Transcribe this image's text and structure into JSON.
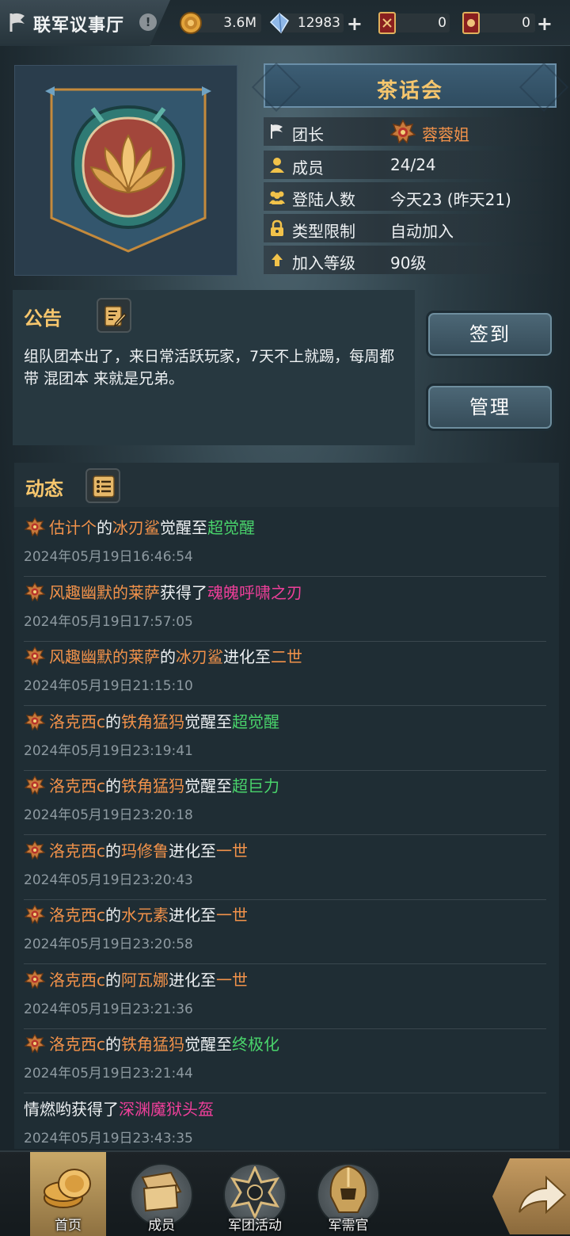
{
  "topbar": {
    "title": "联军议事厅",
    "info_icon": "!",
    "resources": [
      {
        "name": "gold",
        "icon": "coin-icon",
        "value": "3.6M",
        "plus": false
      },
      {
        "name": "diamond",
        "icon": "crystal-icon",
        "value": "12983",
        "plus": true
      },
      {
        "name": "card-a",
        "icon": "card-icon",
        "value": "0",
        "plus": false
      },
      {
        "name": "card-b",
        "icon": "card-icon",
        "value": "0",
        "plus": true
      }
    ]
  },
  "guild": {
    "name": "茶话会",
    "info": [
      {
        "key": "leader",
        "icon": "flag-icon",
        "label": "团长",
        "value": "蓉蓉姐"
      },
      {
        "key": "members",
        "icon": "person-icon",
        "label": "成员",
        "value": "24/24"
      },
      {
        "key": "logins",
        "icon": "group-icon",
        "label": "登陆人数",
        "value": "今天23 (昨天21)"
      },
      {
        "key": "type",
        "icon": "lock-icon",
        "label": "类型限制",
        "value": "自动加入"
      },
      {
        "key": "level",
        "icon": "arrow-up-icon",
        "label": "加入等级",
        "value": "90级"
      }
    ]
  },
  "notice": {
    "title": "公告",
    "text": "组队团本出了，来日常活跃玩家，7天不上就踢，每周都带 混团本 来就是兄弟。"
  },
  "actions": {
    "checkin": "签到",
    "manage": "管理"
  },
  "feed": {
    "title": "动态",
    "items": [
      {
        "icon": true,
        "parts": [
          [
            "估计个",
            "o"
          ],
          [
            "的",
            "w"
          ],
          [
            "冰刃鲨",
            "o"
          ],
          [
            "觉醒至",
            "w"
          ],
          [
            "超觉醒",
            "g"
          ]
        ],
        "time": "2024年05月19日16:46:54"
      },
      {
        "icon": true,
        "parts": [
          [
            "风趣幽默的莱萨",
            "o"
          ],
          [
            "获得了",
            "w"
          ],
          [
            "魂魄呼啸之刃",
            "p"
          ]
        ],
        "time": "2024年05月19日17:57:05"
      },
      {
        "icon": true,
        "parts": [
          [
            "风趣幽默的莱萨",
            "o"
          ],
          [
            "的",
            "w"
          ],
          [
            "冰刃鲨",
            "o"
          ],
          [
            "进化至",
            "w"
          ],
          [
            "二世",
            "o"
          ]
        ],
        "time": "2024年05月19日21:15:10"
      },
      {
        "icon": true,
        "parts": [
          [
            "洛克西c",
            "o"
          ],
          [
            "的",
            "w"
          ],
          [
            "铁角猛犸",
            "o"
          ],
          [
            "觉醒至",
            "w"
          ],
          [
            "超觉醒",
            "g"
          ]
        ],
        "time": "2024年05月19日23:19:41"
      },
      {
        "icon": true,
        "parts": [
          [
            "洛克西c",
            "o"
          ],
          [
            "的",
            "w"
          ],
          [
            "铁角猛犸",
            "o"
          ],
          [
            "觉醒至",
            "w"
          ],
          [
            "超巨力",
            "g"
          ]
        ],
        "time": "2024年05月19日23:20:18"
      },
      {
        "icon": true,
        "parts": [
          [
            "洛克西c",
            "o"
          ],
          [
            "的",
            "w"
          ],
          [
            "玛修鲁",
            "o"
          ],
          [
            "进化至",
            "w"
          ],
          [
            "一世",
            "o"
          ]
        ],
        "time": "2024年05月19日23:20:43"
      },
      {
        "icon": true,
        "parts": [
          [
            "洛克西c",
            "o"
          ],
          [
            "的",
            "w"
          ],
          [
            "水元素",
            "o"
          ],
          [
            "进化至",
            "w"
          ],
          [
            "一世",
            "o"
          ]
        ],
        "time": "2024年05月19日23:20:58"
      },
      {
        "icon": true,
        "parts": [
          [
            "洛克西c",
            "o"
          ],
          [
            "的",
            "w"
          ],
          [
            "阿瓦娜",
            "o"
          ],
          [
            "进化至",
            "w"
          ],
          [
            "一世",
            "o"
          ]
        ],
        "time": "2024年05月19日23:21:36"
      },
      {
        "icon": true,
        "parts": [
          [
            "洛克西c",
            "o"
          ],
          [
            "的",
            "w"
          ],
          [
            "铁角猛犸",
            "o"
          ],
          [
            "觉醒至",
            "w"
          ],
          [
            "终极化",
            "g"
          ]
        ],
        "time": "2024年05月19日23:21:44"
      },
      {
        "icon": false,
        "parts": [
          [
            "情燃哟",
            "w"
          ],
          [
            "获得了",
            "w"
          ],
          [
            "深渊魔狱头盔",
            "p"
          ]
        ],
        "time": "2024年05月19日23:43:35"
      }
    ]
  },
  "nav": [
    {
      "key": "home",
      "label": "首页",
      "active": true,
      "icon": "coins-icon"
    },
    {
      "key": "members",
      "label": "成员",
      "active": false,
      "icon": "scroll-icon"
    },
    {
      "key": "events",
      "label": "军团活动",
      "active": false,
      "icon": "star-icon"
    },
    {
      "key": "quartermaster",
      "label": "军需官",
      "active": false,
      "icon": "helmet-icon"
    }
  ],
  "colors": {
    "orange": "#f2924a",
    "green": "#49d36b",
    "pink": "#ef3f9a",
    "gold": "#f6c66d"
  }
}
